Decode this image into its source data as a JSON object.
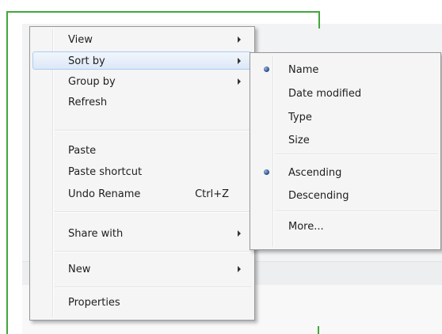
{
  "context_menu": {
    "items": [
      {
        "label": "View",
        "has_submenu": true
      },
      {
        "label": "Sort by",
        "has_submenu": true,
        "highlighted": true
      },
      {
        "label": "Group by",
        "has_submenu": true
      },
      {
        "label": "Refresh"
      },
      {
        "label": "Paste"
      },
      {
        "label": "Paste shortcut"
      },
      {
        "label": "Undo Rename",
        "shortcut": "Ctrl+Z"
      },
      {
        "label": "Share with",
        "has_submenu": true
      },
      {
        "label": "New",
        "has_submenu": true
      },
      {
        "label": "Properties"
      }
    ]
  },
  "sort_submenu": {
    "items": [
      {
        "label": "Name",
        "checked": true
      },
      {
        "label": "Date modified",
        "checked": false
      },
      {
        "label": "Type",
        "checked": false
      },
      {
        "label": "Size",
        "checked": false
      },
      {
        "label": "Ascending",
        "checked": true
      },
      {
        "label": "Descending",
        "checked": false
      },
      {
        "label": "More...",
        "checked": false
      }
    ]
  },
  "colors": {
    "highlight_border": "#aecbf0",
    "frame_green": "#43a83a",
    "radio_dot": "#21468a"
  }
}
